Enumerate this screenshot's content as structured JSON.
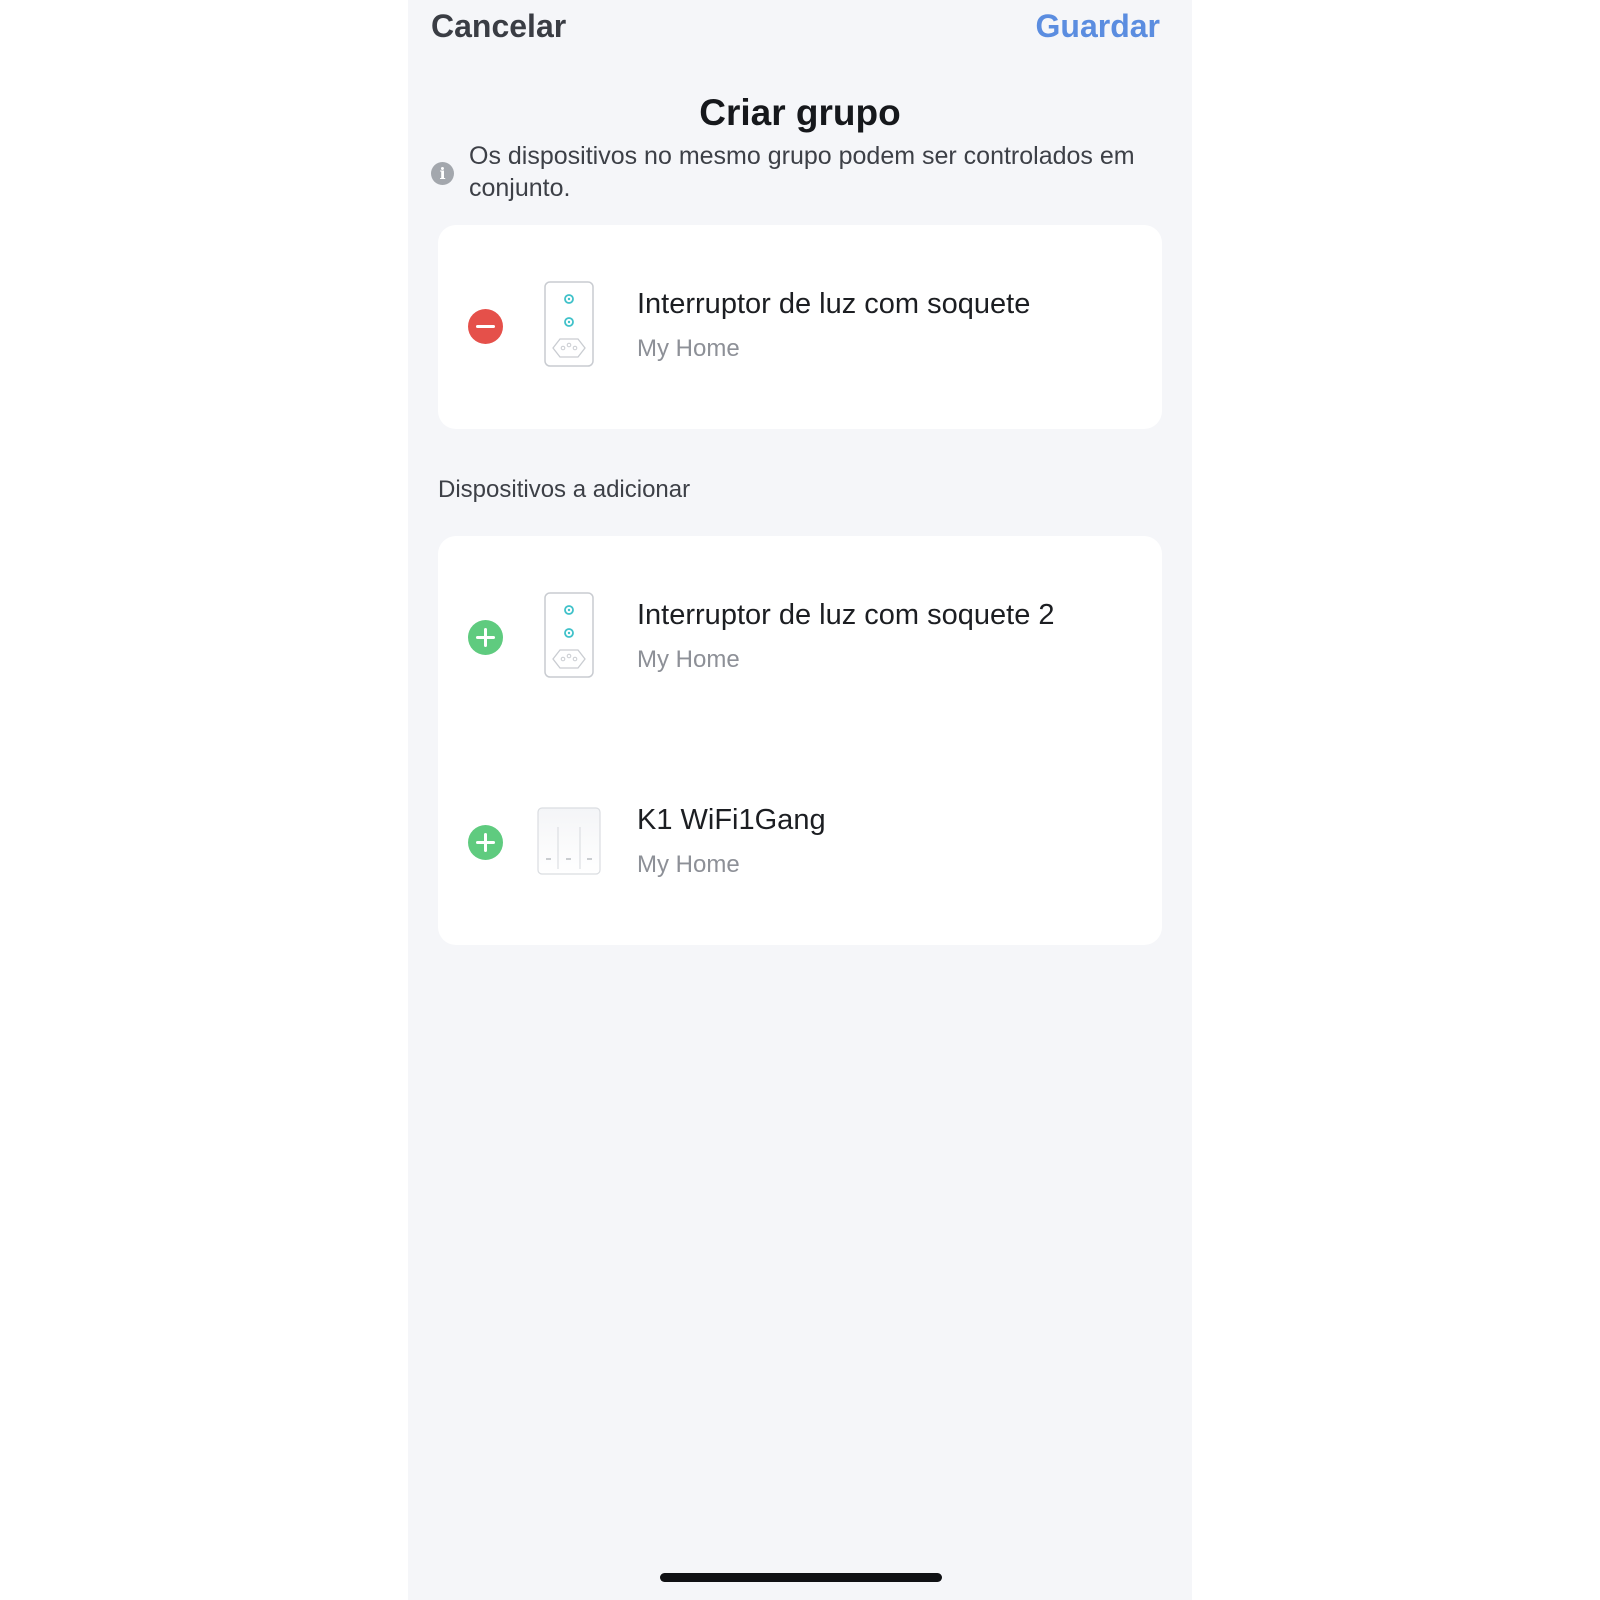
{
  "nav": {
    "cancel_label": "Cancelar",
    "save_label": "Guardar"
  },
  "page": {
    "title": "Criar grupo",
    "info_text": "Os dispositivos no mesmo grupo podem ser controlados em conjunto."
  },
  "group_devices": [
    {
      "name": "Interruptor de luz com soquete",
      "home": "My Home",
      "action": "remove",
      "icon": "wall-socket-switch-icon"
    }
  ],
  "section": {
    "label": "Dispositivos a adicionar"
  },
  "available_devices": [
    {
      "name": "Interruptor de luz com soquete 2",
      "home": "My Home",
      "action": "add",
      "icon": "wall-socket-switch-icon"
    },
    {
      "name": "K1 WiFi1Gang",
      "home": "My Home",
      "action": "add",
      "icon": "wall-switch-panel-icon"
    }
  ],
  "colors": {
    "accent": "#5b8de0",
    "remove": "#e5504a",
    "add": "#5fcb7f",
    "background": "#f5f6f9"
  }
}
